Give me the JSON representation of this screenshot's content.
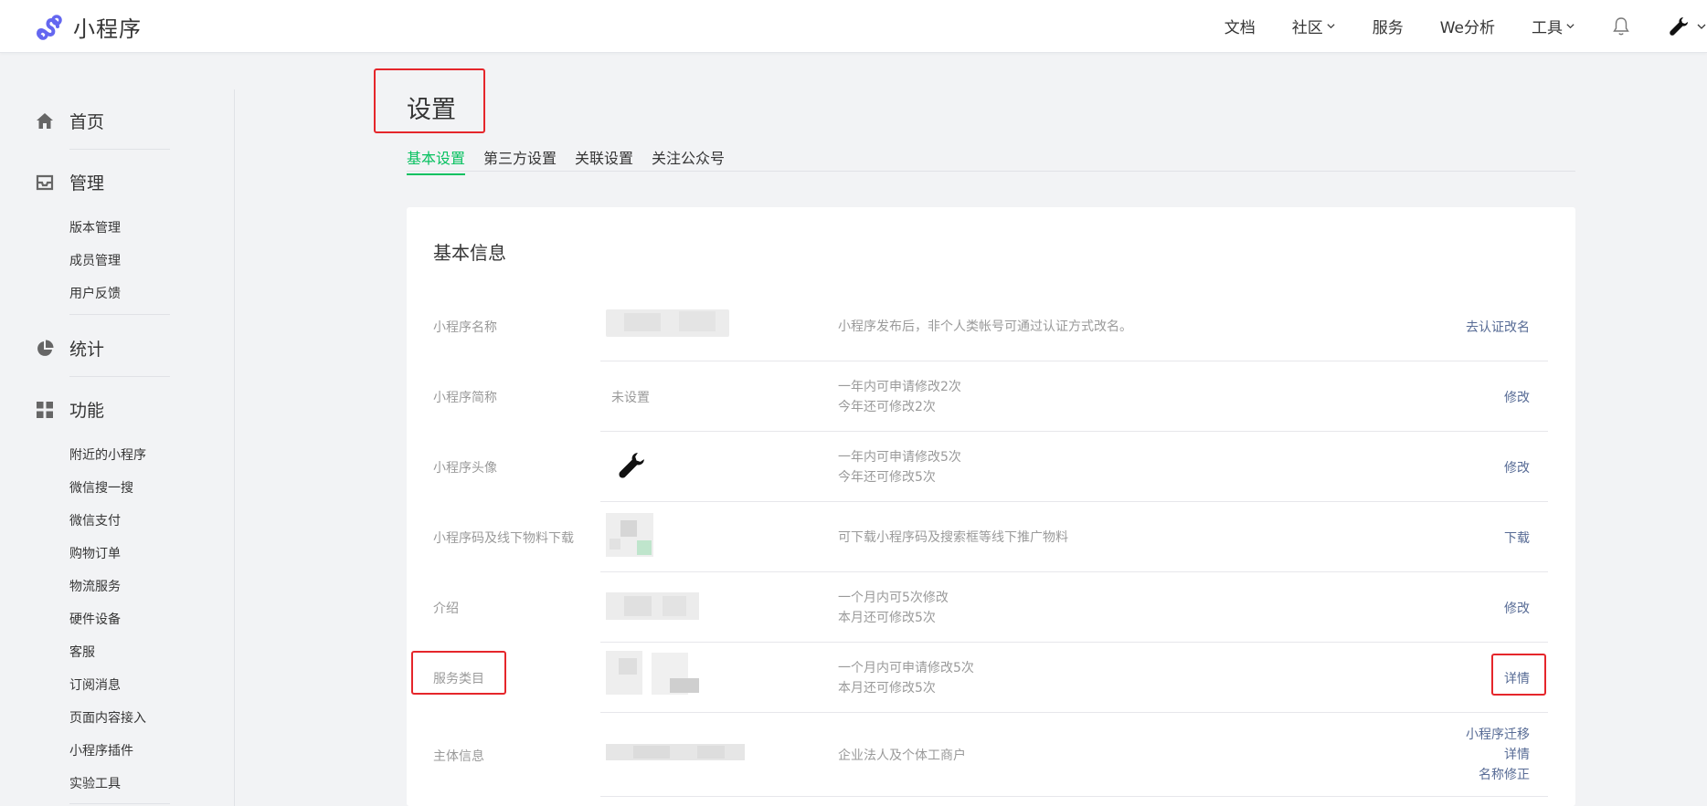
{
  "app": {
    "name": "小程序"
  },
  "topnav": {
    "items": [
      "文档",
      "社区",
      "服务",
      "We分析",
      "工具"
    ]
  },
  "sidebar": {
    "sections": [
      {
        "label": "首页",
        "icon": "home-icon"
      },
      {
        "label": "管理",
        "icon": "inbox-icon",
        "items": [
          "版本管理",
          "成员管理",
          "用户反馈"
        ]
      },
      {
        "label": "统计",
        "icon": "pie-chart-icon"
      },
      {
        "label": "功能",
        "icon": "grid-icon",
        "items": [
          "附近的小程序",
          "微信搜一搜",
          "微信支付",
          "购物订单",
          "物流服务",
          "硬件设备",
          "客服",
          "订阅消息",
          "页面内容接入",
          "小程序插件",
          "实验工具"
        ]
      }
    ]
  },
  "page": {
    "title": "设置",
    "tabs": [
      "基本设置",
      "第三方设置",
      "关联设置",
      "关注公众号"
    ],
    "active_tab": "基本设置"
  },
  "card": {
    "title": "基本信息",
    "rows": [
      {
        "label": "小程序名称",
        "value": "",
        "desc": [
          "小程序发布后，非个人类帐号可通过认证方式改名。"
        ],
        "actions": [
          "去认证改名"
        ]
      },
      {
        "label": "小程序简称",
        "value": "未设置",
        "desc": [
          "一年内可申请修改2次",
          "今年还可修改2次"
        ],
        "actions": [
          "修改"
        ]
      },
      {
        "label": "小程序头像",
        "value": "",
        "desc": [
          "一年内可申请修改5次",
          "今年还可修改5次"
        ],
        "actions": [
          "修改"
        ]
      },
      {
        "label": "小程序码及线下物料下载",
        "value": "",
        "desc": [
          "可下载小程序码及搜索框等线下推广物料"
        ],
        "actions": [
          "下载"
        ]
      },
      {
        "label": "介绍",
        "value": "",
        "desc": [
          "一个月内可5次修改",
          "本月还可修改5次"
        ],
        "actions": [
          "修改"
        ]
      },
      {
        "label": "服务类目",
        "value": "",
        "desc": [
          "一个月内可申请修改5次",
          "本月还可修改5次"
        ],
        "actions": [
          "详情"
        ]
      },
      {
        "label": "主体信息",
        "value": "",
        "desc": [
          "企业法人及个体工商户"
        ],
        "actions": [
          "小程序迁移",
          "详情",
          "名称修正"
        ]
      }
    ]
  },
  "colors": {
    "accent": "#07c160",
    "link": "#576b95",
    "highlight": "#e5262b",
    "logo": "#6467f0"
  }
}
